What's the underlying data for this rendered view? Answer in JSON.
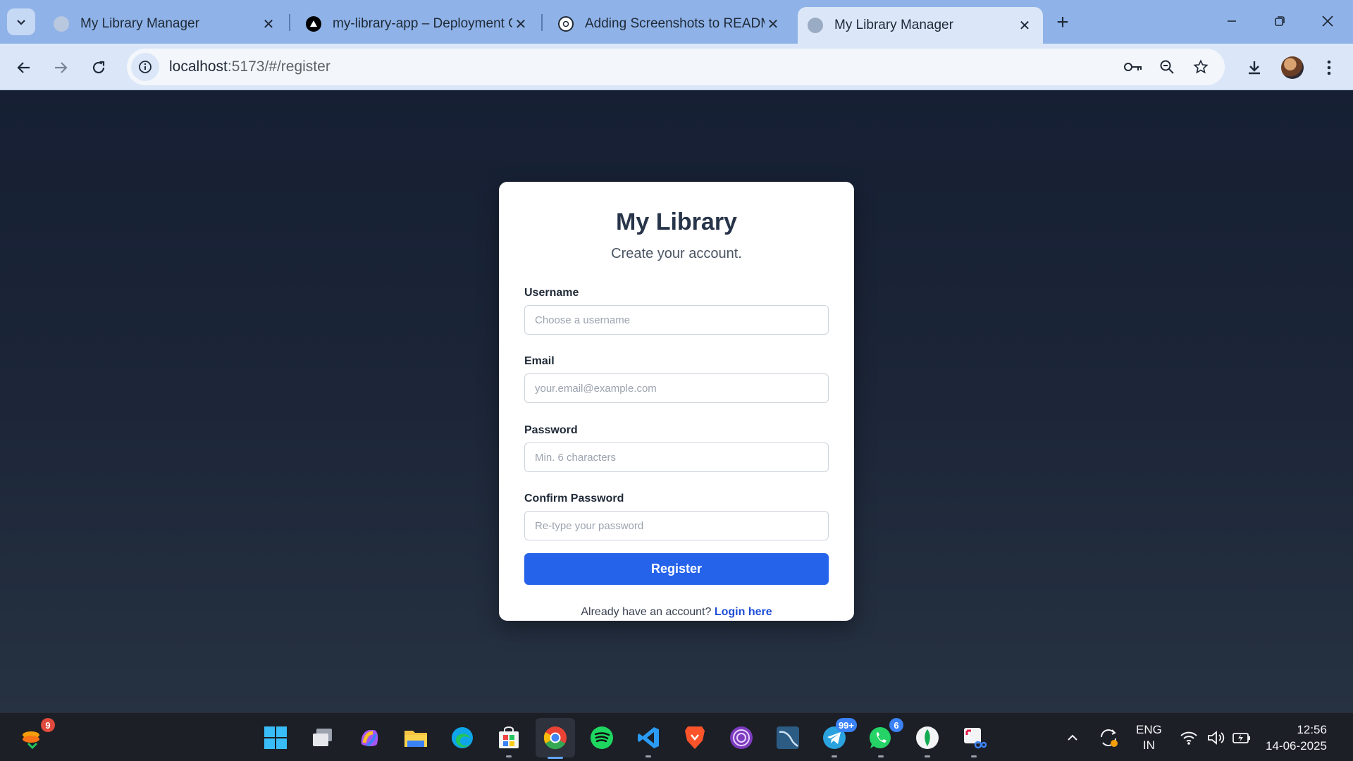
{
  "browser": {
    "tabs": [
      {
        "title": "My Library Manager",
        "active": false
      },
      {
        "title": "my-library-app – Deployment O",
        "active": false
      },
      {
        "title": "Adding Screenshots to READM",
        "active": false
      },
      {
        "title": "My Library Manager",
        "active": true
      }
    ],
    "url_host": "localhost",
    "url_rest": ":5173/#/register"
  },
  "form": {
    "title": "My Library",
    "subtitle": "Create your account.",
    "fields": [
      {
        "label": "Username",
        "placeholder": "Choose a username"
      },
      {
        "label": "Email",
        "placeholder": "your.email@example.com"
      },
      {
        "label": "Password",
        "placeholder": "Min. 6 characters"
      },
      {
        "label": "Confirm Password",
        "placeholder": "Re-type your password"
      }
    ],
    "submit_label": "Register",
    "footer_text": "Already have an account?",
    "footer_link": "Login here"
  },
  "taskbar": {
    "weather_badge": "9",
    "telegram_badge": "99+",
    "whatsapp_badge": "6",
    "language_line1": "ENG",
    "language_line2": "IN",
    "time": "12:56",
    "date": "14-06-2025"
  },
  "colors": {
    "accent": "#2563eb",
    "page_bg": "#1c2638",
    "card_bg": "#ffffff"
  }
}
